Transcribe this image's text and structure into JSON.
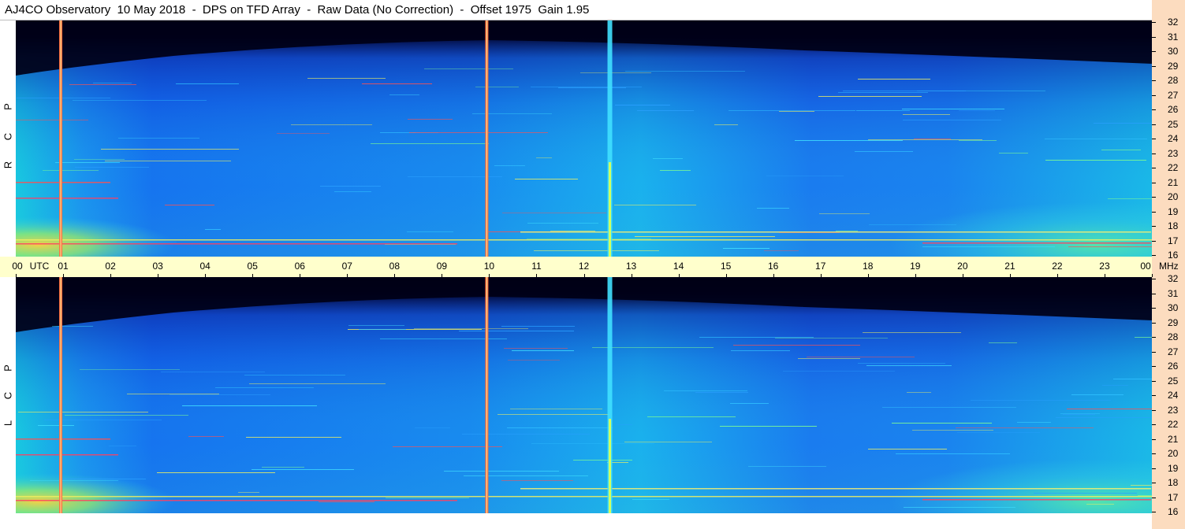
{
  "title": "AJ4CO Observatory  10 May 2018  -  DPS on TFD Array  -  Raw Data (No Correction)  -  Offset 1975  Gain 1.95",
  "chart_data": {
    "type": "heatmap",
    "title": "AJ4CO Observatory  10 May 2018  -  DPS on TFD Array  -  Raw Data (No Correction)  -  Offset 1975  Gain 1.95",
    "x_label": "UTC",
    "x_ticks": [
      "00",
      "01",
      "02",
      "03",
      "04",
      "05",
      "06",
      "07",
      "08",
      "09",
      "10",
      "11",
      "12",
      "13",
      "14",
      "15",
      "16",
      "17",
      "18",
      "19",
      "20",
      "21",
      "22",
      "23",
      "00"
    ],
    "x_unit_labels": [
      "UTC",
      "MHz"
    ],
    "y_ticks": [
      "16",
      "17",
      "18",
      "19",
      "20",
      "21",
      "22",
      "23",
      "24",
      "25",
      "26",
      "27",
      "28",
      "29",
      "30",
      "31",
      "32"
    ],
    "y_range": [
      16,
      32
    ],
    "x_range_hours": [
      0,
      24
    ],
    "panels": [
      {
        "name": "R C P",
        "letters": [
          "R",
          "C",
          "P"
        ]
      },
      {
        "name": "L C P",
        "letters": [
          "L",
          "C",
          "P"
        ]
      }
    ],
    "colormap": [
      "#000015",
      "#0a3acc",
      "#1a7af0",
      "#1fd0e8",
      "#60f0a0",
      "#f5f050",
      "#ff3a30",
      "#c01070"
    ],
    "vertical_bursts_hours": [
      0.95,
      9.95,
      12.55
    ]
  }
}
